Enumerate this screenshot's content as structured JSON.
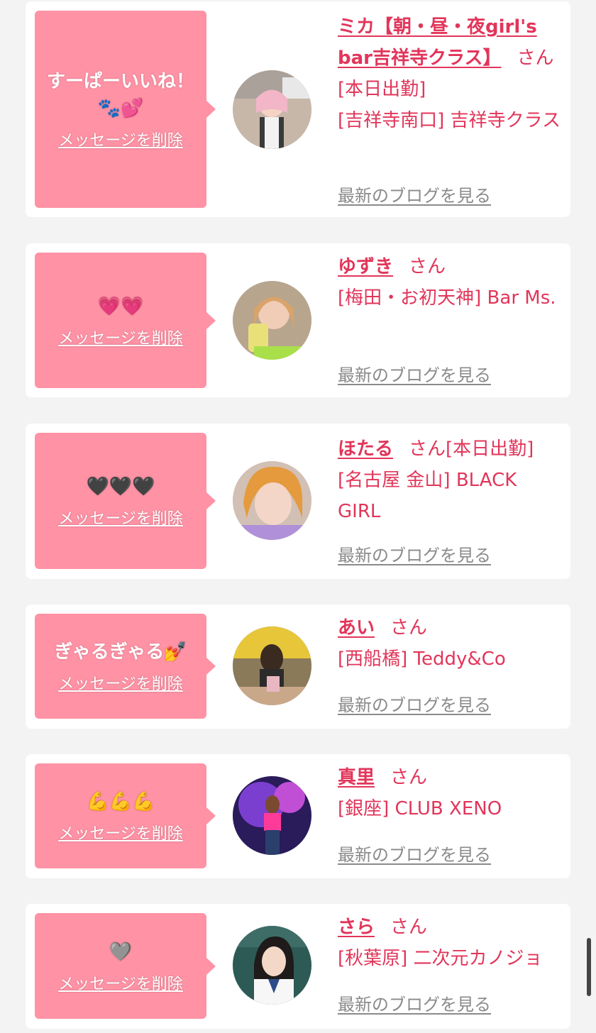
{
  "colors": {
    "accent": "#e2355a",
    "bubble": "#ff92a5",
    "link_gray": "#8a8a8a"
  },
  "delete_label": "メッセージを削除",
  "blog_label": "最新のブログを見る",
  "cards": [
    {
      "message": "すーぱーいいね！\n🐾💕",
      "name": "ミカ【朝・昼・夜girl's bar吉祥寺クラス】",
      "suffix": "さん",
      "detail": "[本日出勤]\n[吉祥寺南口] 吉祥寺クラス"
    },
    {
      "message": "💗💗",
      "name": "ゆずき",
      "suffix": "さん",
      "detail": "[梅田・お初天神] Bar Ms."
    },
    {
      "message": "🖤🖤🖤",
      "name": "ほたる",
      "suffix": "さん",
      "detail": "[本日出勤]\n[名古屋 金山] BLACK GIRL"
    },
    {
      "message": "ぎゃるぎゃる💅",
      "name": "あい",
      "suffix": "さん",
      "detail": "[西船橋] Teddy&Co"
    },
    {
      "message": "💪💪💪",
      "name": "真里",
      "suffix": "さん",
      "detail": "[銀座] CLUB XENO"
    },
    {
      "message": "🩶",
      "name": "さら",
      "suffix": "さん",
      "detail": "[秋葉原] 二次元カノジョ"
    }
  ]
}
